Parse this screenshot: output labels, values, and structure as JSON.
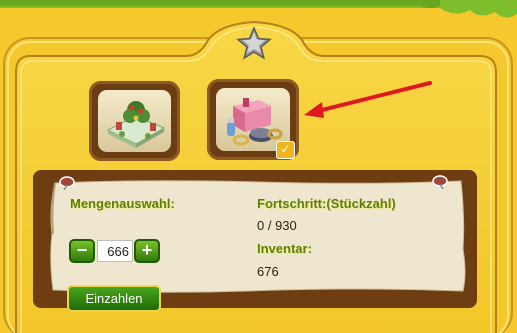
{
  "tabs": [
    {
      "icon": "garden-decoration-icon",
      "selected": false
    },
    {
      "icon": "craft-supplies-icon",
      "selected": true,
      "badge_icon": "checkmark-icon"
    }
  ],
  "rank_icon": "star-icon",
  "pointer_icon": "red-arrow-icon",
  "quantity": {
    "label": "Mengenauswahl:",
    "value": "666",
    "decrement_label": "−",
    "increment_label": "+"
  },
  "progress": {
    "label": "Fortschritt:(Stückzahl)",
    "value": "0 / 930",
    "fraction": 0
  },
  "inventory": {
    "label": "Inventar:",
    "value": "676"
  },
  "deposit_button": {
    "label": "Einzahlen"
  },
  "colors": {
    "background": "#f3c52b",
    "wood": "#6e3d12",
    "parchment": "#efe6cf",
    "label_green": "#5d7d12",
    "button_green": "#2f7a0c",
    "arrow_red": "#e0191f"
  }
}
